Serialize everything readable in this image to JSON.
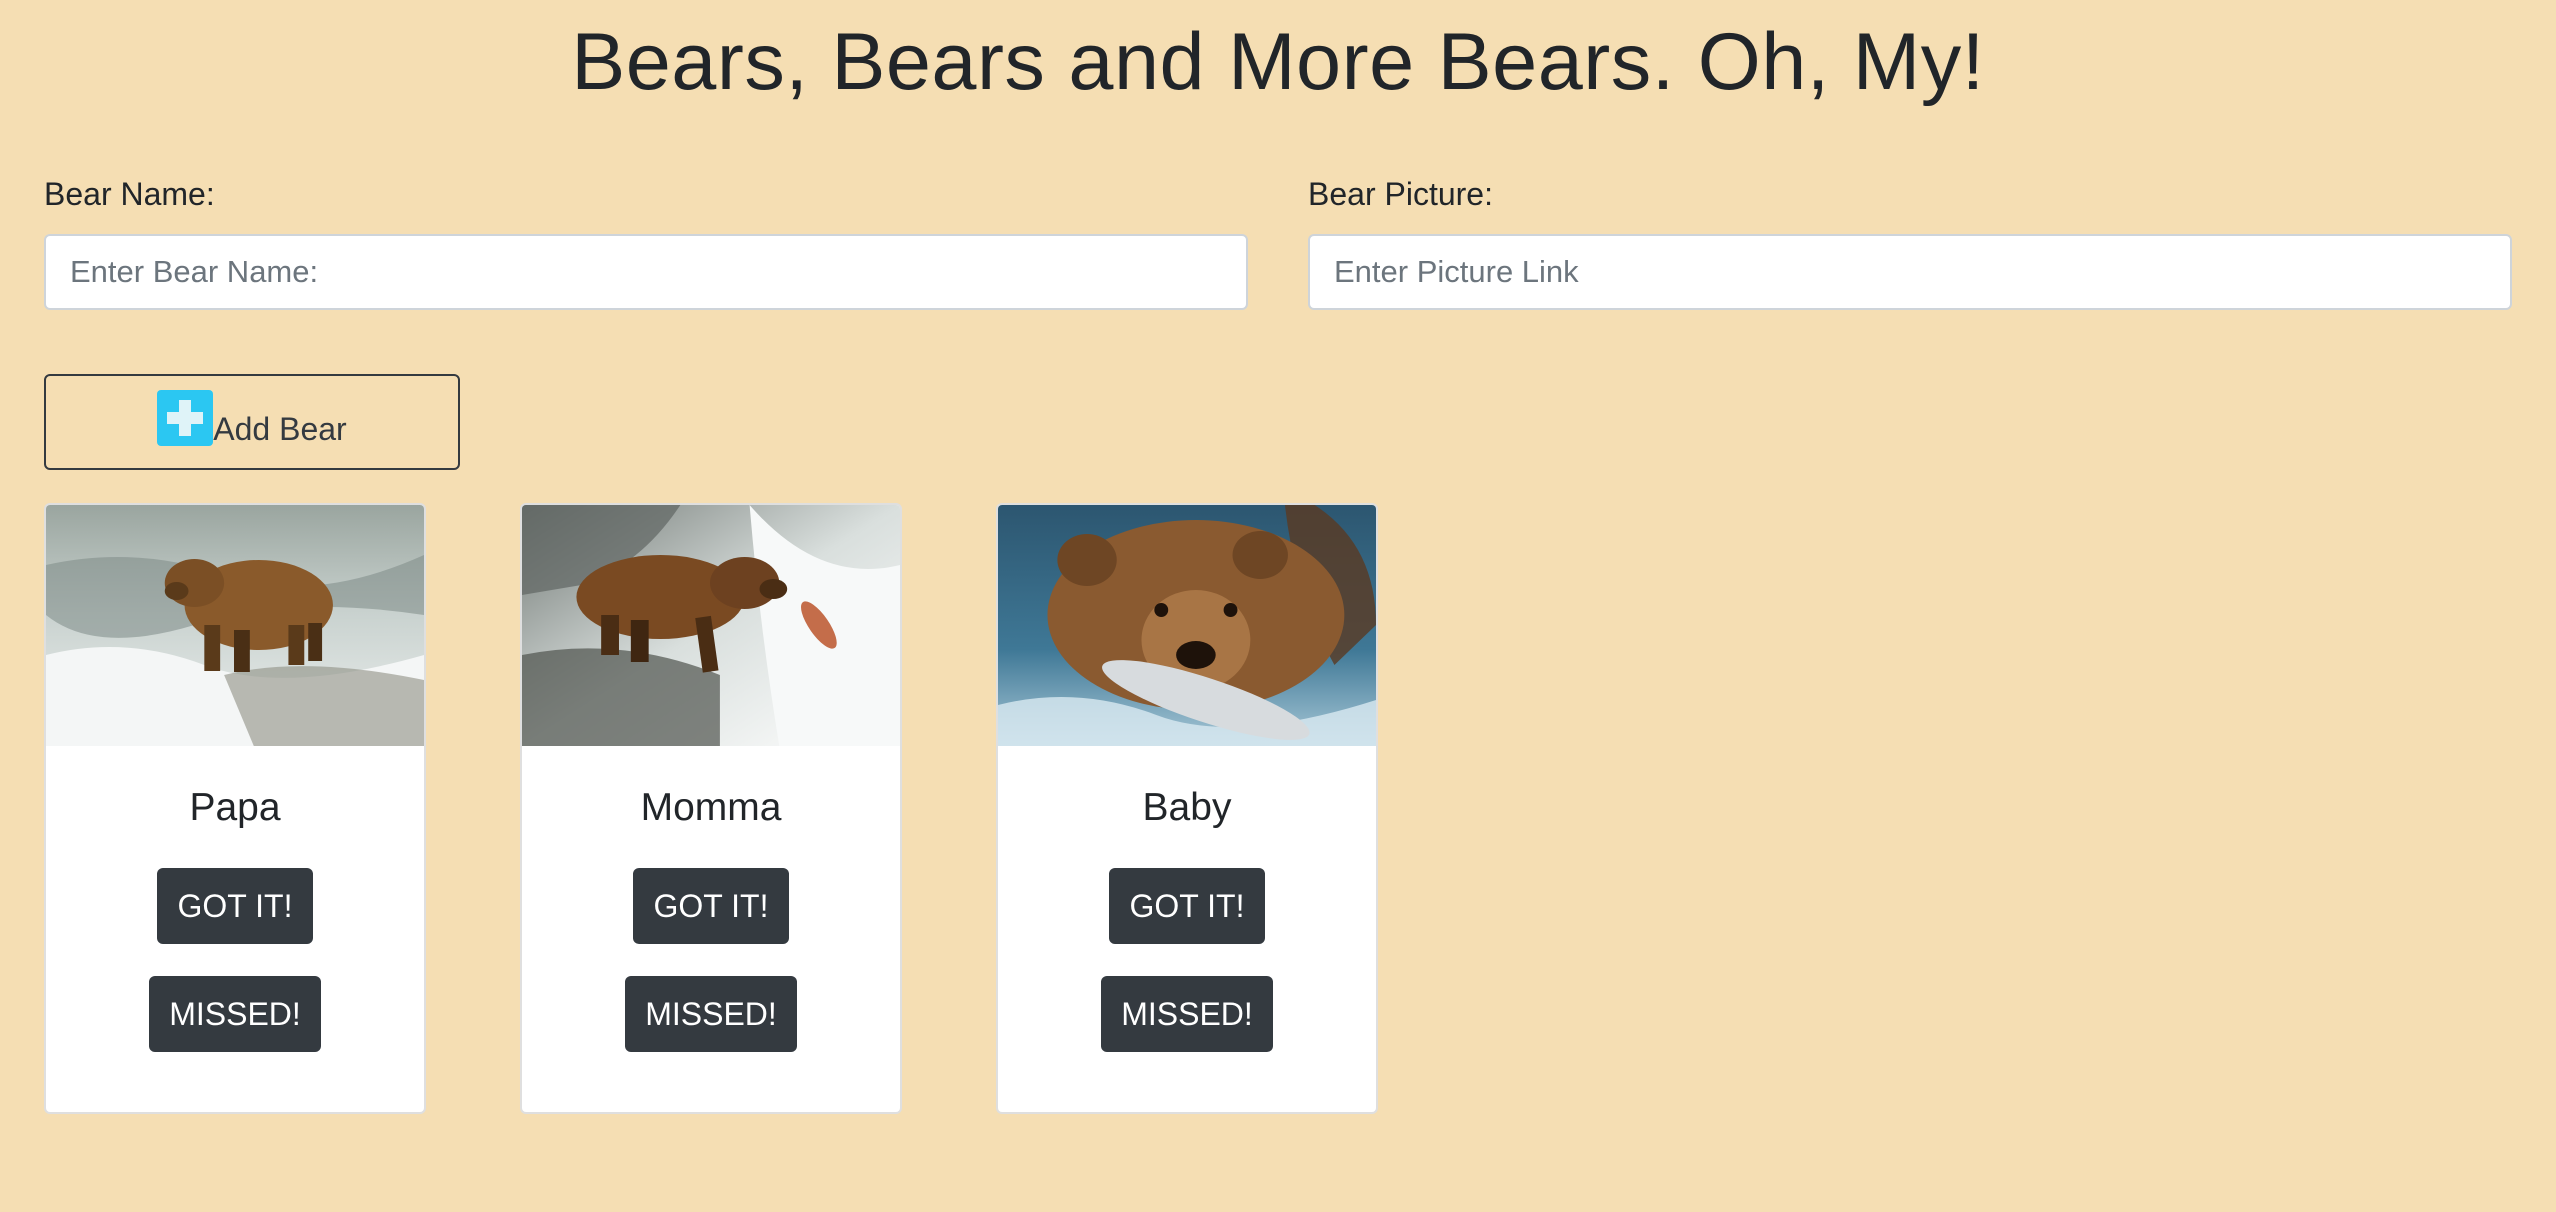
{
  "page": {
    "title": "Bears, Bears and More Bears. Oh, My!"
  },
  "form": {
    "name_label": "Bear Name:",
    "name_placeholder": "Enter Bear Name:",
    "name_value": "",
    "picture_label": "Bear Picture:",
    "picture_placeholder": "Enter Picture Link",
    "picture_value": "",
    "add_button_label": "Add Bear",
    "add_icon": "plus-square-icon"
  },
  "bears": [
    {
      "name": "Papa",
      "got_label": "GOT IT!",
      "missed_label": "MISSED!"
    },
    {
      "name": "Momma",
      "got_label": "GOT IT!",
      "missed_label": "MISSED!"
    },
    {
      "name": "Baby",
      "got_label": "GOT IT!",
      "missed_label": "MISSED!"
    }
  ],
  "colors": {
    "page_background": "#f5deb3",
    "button_dark": "#343a40",
    "add_icon": "#2bc7f2"
  }
}
